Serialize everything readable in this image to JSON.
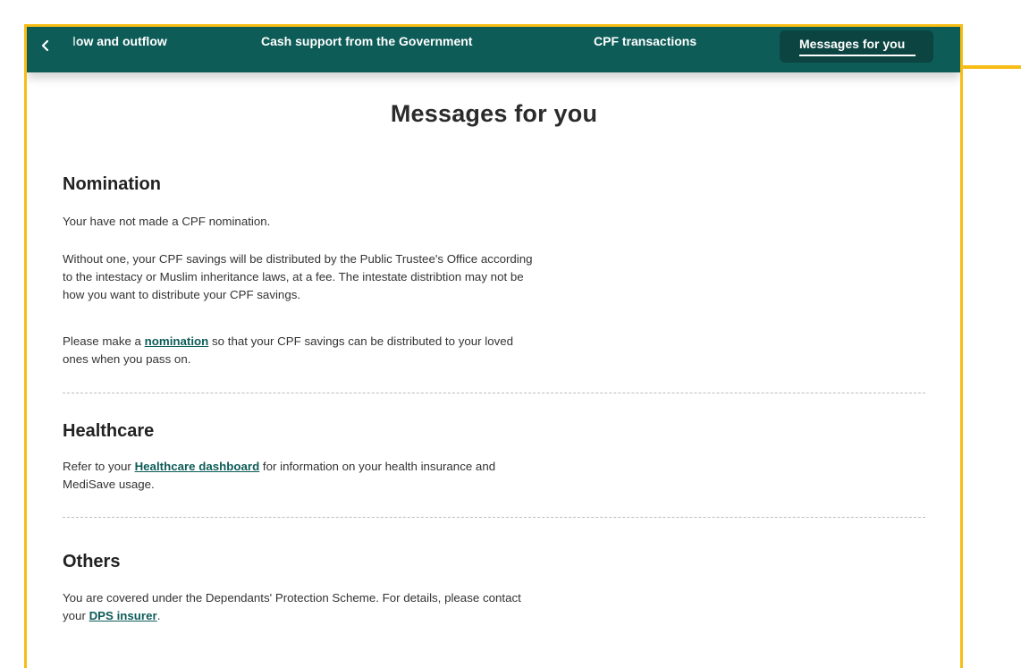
{
  "tabs": {
    "back_icon": "chevron-left-icon",
    "items": [
      {
        "label": "Inflow and outflow",
        "visible_label": "low and outflow"
      },
      {
        "label": "Cash support from the Government"
      },
      {
        "label": "CPF transactions"
      },
      {
        "label": "Messages for you",
        "active": true
      }
    ]
  },
  "page": {
    "title": "Messages for you"
  },
  "sections": {
    "nomination": {
      "title": "Nomination",
      "p1": "Your have not made a CPF nomination.",
      "p2_line1": "Without one, your CPF savings will be distributed by the Public Trustee's Office according",
      "p2_line2": "to the intestacy or Muslim inheritance laws, at a fee. The intestate distribtion may not be",
      "p2_line3": "how you want to distribute your CPF savings.",
      "p3_before": "Please make a ",
      "p3_link": "nomination",
      "p3_after_line1": " so that your CPF savings can be distributed to your loved",
      "p3_line2": "ones when you pass on."
    },
    "healthcare": {
      "title": "Healthcare",
      "p_before": "Refer to your ",
      "p_link": "Healthcare dashboard",
      "p_after_line1": " for information on your health insurance and",
      "p_line2": "MediSave usage."
    },
    "others": {
      "title": "Others",
      "p_line1": "You are covered under the Dependants' Protection Scheme. For details, please contact",
      "p_before": "your ",
      "p_link": "DPS insurer",
      "p_after": "."
    }
  },
  "colors": {
    "tabbar": "#0d5c58",
    "active_tab": "#0b4441",
    "link": "#0d5c58",
    "highlight": "#f8bd14"
  }
}
